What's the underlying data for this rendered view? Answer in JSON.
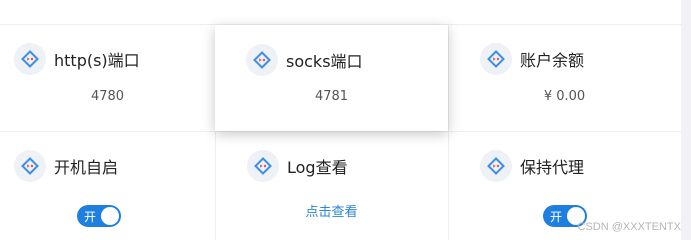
{
  "cards": {
    "http": {
      "title": "http(s)端口",
      "value": "4780"
    },
    "socks": {
      "title": "socks端口",
      "value": "4781"
    },
    "balance": {
      "title": "账户余额",
      "value": "¥ 0.00"
    },
    "autostart": {
      "title": "开机自启",
      "toggle_label": "开"
    },
    "log": {
      "title": "Log查看",
      "link": "点击查看"
    },
    "keep_proxy": {
      "title": "保持代理",
      "toggle_label": "开"
    }
  },
  "watermark": "CSDN @XXXTENTX",
  "colors": {
    "accent": "#1e7fe0",
    "link": "#2a86d6",
    "icon_bg": "#eef1f5",
    "icon_blue": "#3b8fe8",
    "icon_red": "#e8514f"
  },
  "icon": "proxy-diamond-icon"
}
